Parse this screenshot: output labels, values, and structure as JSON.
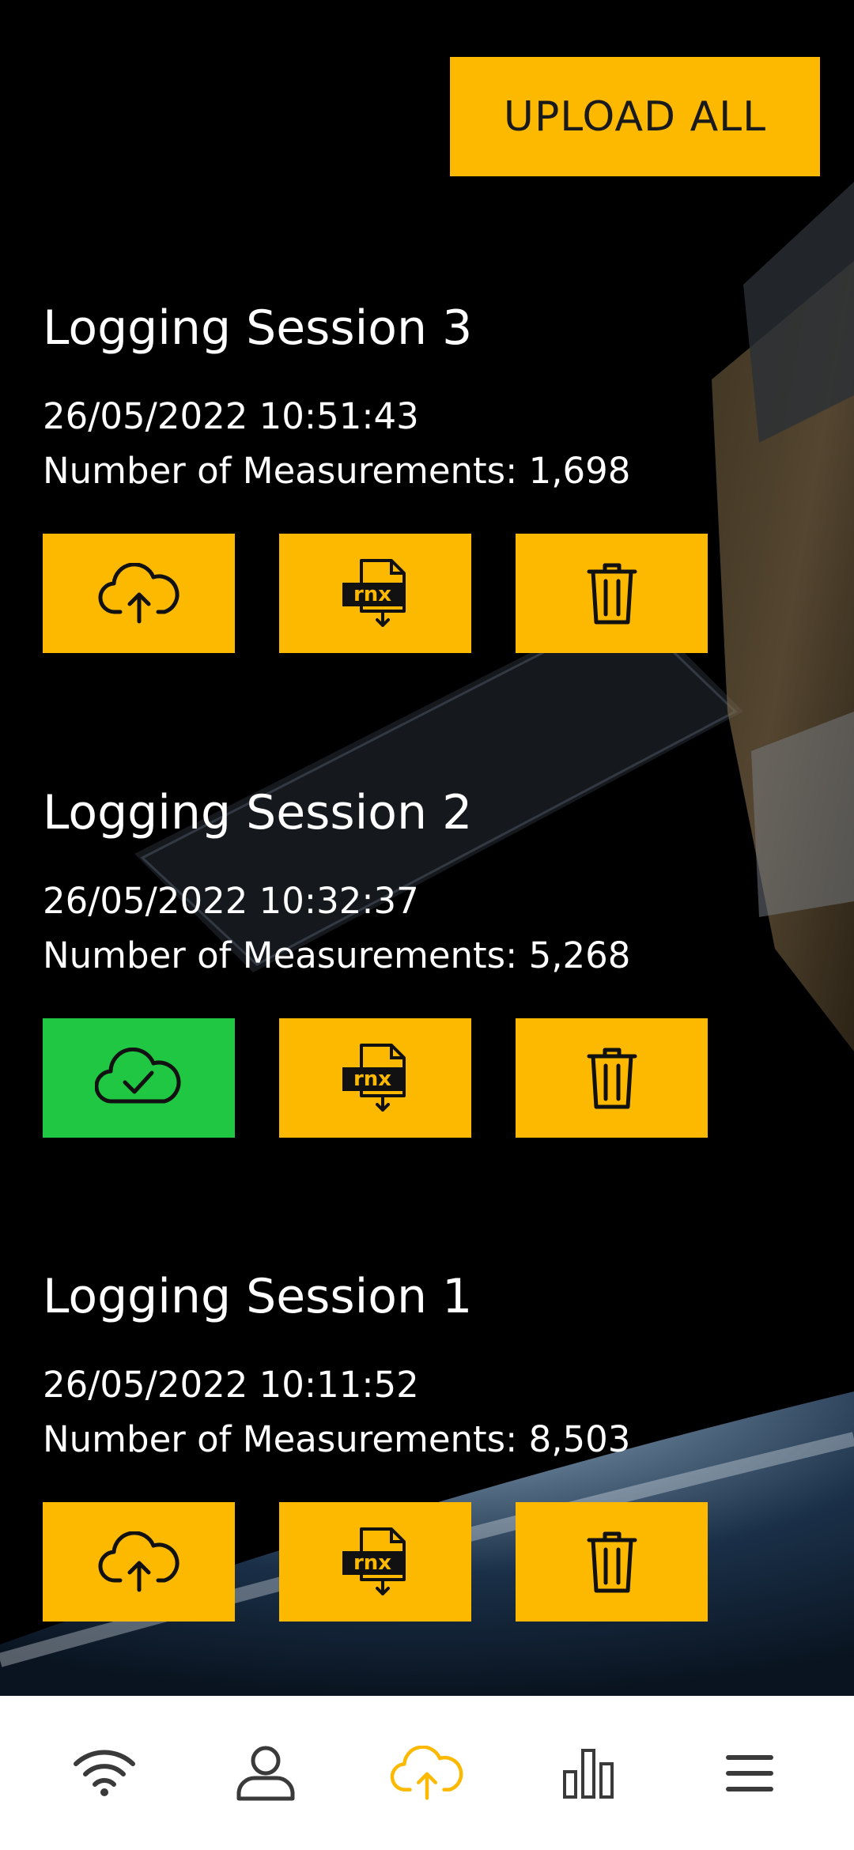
{
  "header": {
    "upload_all_label": "UPLOAD ALL"
  },
  "colors": {
    "accent": "#FDB900",
    "success": "#1FC742",
    "background": "#000000",
    "nav_bg": "#FFFFFF",
    "nav_active": "#FDB900",
    "nav_inactive": "#3A3A3A"
  },
  "sessions": [
    {
      "title": "Logging Session 3",
      "datetime": "26/05/2022 10:51:43",
      "measurements": "Number of Measurements: 1,698",
      "upload_state": "cloud-upload-icon"
    },
    {
      "title": "Logging Session 2",
      "datetime": "26/05/2022 10:32:37",
      "measurements": "Number of Measurements: 5,268",
      "upload_state": "cloud-check-icon"
    },
    {
      "title": "Logging Session 1",
      "datetime": "26/05/2022 10:11:52",
      "measurements": "Number of Measurements: 8,503",
      "upload_state": "cloud-upload-icon"
    }
  ],
  "rinex_icon_text": "rnx",
  "bottom_nav": [
    {
      "icon": "wifi-icon",
      "active": false
    },
    {
      "icon": "user-icon",
      "active": false
    },
    {
      "icon": "cloud-upload-icon",
      "active": true
    },
    {
      "icon": "bar-chart-icon",
      "active": false
    },
    {
      "icon": "menu-icon",
      "active": false
    }
  ]
}
